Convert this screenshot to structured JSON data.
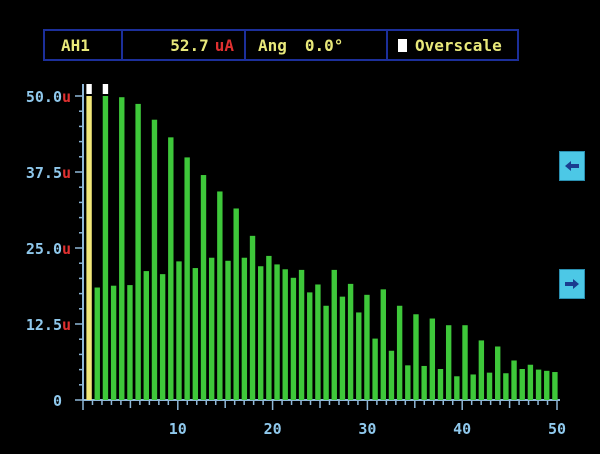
{
  "header": {
    "channel": "AH1",
    "value": "52.7",
    "unit": "uA",
    "angle_label": "Ang",
    "angle_value": "0.0°",
    "overscale_label": "Overscale"
  },
  "nav": {
    "left_icon": "arrow-left-icon",
    "right_icon": "arrow-right-icon"
  },
  "colors": {
    "background": "#000000",
    "bar": "#3ec83a",
    "fundamental": "#f2e87a",
    "overscale": "#ffffff",
    "axis": "#8fb8d8",
    "tick_text": "#8fc8ec",
    "unit_text": "#e03030",
    "header_border": "#1c2f9a",
    "header_text": "#e8e87a"
  },
  "chart_data": {
    "type": "bar",
    "xlim": [
      0,
      50
    ],
    "ylim": [
      0,
      50.0
    ],
    "yticks": [
      {
        "value": 0,
        "label": "0",
        "unit": ""
      },
      {
        "value": 12.5,
        "label": "12.5",
        "unit": "u"
      },
      {
        "value": 25.0,
        "label": "25.0",
        "unit": "u"
      },
      {
        "value": 37.5,
        "label": "37.5",
        "unit": "u"
      },
      {
        "value": 50.0,
        "label": "50.0",
        "unit": "u"
      }
    ],
    "xticks": [
      10,
      20,
      30,
      40,
      50
    ],
    "harmonics": [
      1,
      2,
      3,
      4,
      5,
      6,
      7,
      8,
      9,
      10,
      11,
      12,
      13,
      14,
      15,
      16,
      17,
      18,
      19,
      20,
      21,
      22,
      23,
      24,
      25,
      26,
      27,
      28,
      29,
      30,
      31,
      32,
      33,
      34,
      35,
      36,
      37,
      38,
      39,
      40,
      41,
      42,
      43,
      44,
      45,
      46,
      47,
      48,
      49,
      50
    ],
    "values": [
      52.7,
      18.5,
      52.0,
      18.8,
      49.8,
      18.9,
      48.7,
      21.2,
      46.1,
      20.7,
      43.2,
      22.8,
      39.9,
      21.7,
      37.0,
      23.4,
      34.3,
      22.9,
      31.5,
      23.4,
      27.0,
      22.0,
      23.7,
      22.3,
      21.5,
      20.1,
      21.4,
      17.7,
      19.0,
      15.5,
      21.4,
      17.0,
      19.1,
      14.4,
      17.3,
      10.1,
      18.2,
      8.1,
      15.5,
      5.7,
      14.1,
      5.6,
      13.4,
      5.1,
      12.3,
      3.9,
      12.3,
      4.2,
      9.8,
      4.5,
      8.8,
      4.4,
      6.5,
      5.1,
      5.8,
      5.0,
      4.8,
      4.6
    ],
    "overscale": [
      1,
      3
    ]
  }
}
